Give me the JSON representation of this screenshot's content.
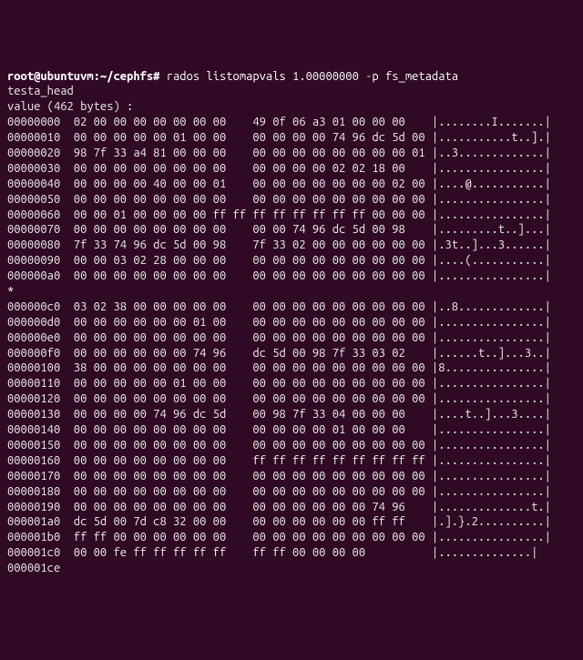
{
  "prompt": "root@ubuntuvm:~/cephfs#",
  "command": "rados listomapvals 1.00000000 -p fs_metadata",
  "header1": "testa_head",
  "header2": "value (462 bytes) :",
  "rows": [
    {
      "off": "00000000",
      "h1": "02 00 00 00 00 00 00 00",
      "h2": "49 0f 06 a3 01 00 00 00",
      "a": "|........I.......|"
    },
    {
      "off": "00000010",
      "h1": "00 00 00 00 00 01 00 00",
      "h2": "00 00 00 00 74 96 dc 5d 00",
      "a": "|...........t..].|"
    },
    {
      "off": "00000020",
      "h1": "98 7f 33 a4 81 00 00 00",
      "h2": "00 00 00 00 00 00 00 00 01",
      "a": "|..3.............|"
    },
    {
      "off": "00000030",
      "h1": "00 00 00 00 00 00 00 00",
      "h2": "00 00 00 00 02 02 18 00",
      "a": "|................|"
    },
    {
      "off": "00000040",
      "h1": "00 00 00 00 40 00 00 01",
      "h2": "00 00 00 00 00 00 00 02 00",
      "a": "|....@...........|"
    },
    {
      "off": "00000050",
      "h1": "00 00 00 00 00 00 00 00",
      "h2": "00 00 00 00 00 00 00 00 00",
      "a": "|................|"
    },
    {
      "off": "00000060",
      "h1": "00 00 01 00 00 00 00 ff ff",
      "h2": "ff ff ff ff ff ff 00 00 00",
      "a": "|................|"
    },
    {
      "off": "00000070",
      "h1": "00 00 00 00 00 00 00 00",
      "h2": "00 00 74 96 dc 5d 00 98",
      "a": "|.........t..]...|"
    },
    {
      "off": "00000080",
      "h1": "7f 33 74 96 dc 5d 00 98",
      "h2": "7f 33 02 00 00 00 00 00 00",
      "a": "|.3t..]...3......|"
    },
    {
      "off": "00000090",
      "h1": "00 00 03 02 28 00 00 00",
      "h2": "00 00 00 00 00 00 00 00 00",
      "a": "|....(...........|"
    },
    {
      "off": "000000a0",
      "h1": "00 00 00 00 00 00 00 00",
      "h2": "00 00 00 00 00 00 00 00 00",
      "a": "|................|"
    },
    {
      "off": "*",
      "h1": "",
      "h2": "",
      "a": ""
    },
    {
      "off": "000000c0",
      "h1": "03 02 38 00 00 00 00 00",
      "h2": "00 00 00 00 00 00 00 00 00",
      "a": "|..8.............|"
    },
    {
      "off": "000000d0",
      "h1": "00 00 00 00 00 00 01 00",
      "h2": "00 00 00 00 00 00 00 00 00",
      "a": "|................|"
    },
    {
      "off": "000000e0",
      "h1": "00 00 00 00 00 00 00 00",
      "h2": "00 00 00 00 00 00 00 00 00",
      "a": "|................|"
    },
    {
      "off": "000000f0",
      "h1": "00 00 00 00 00 00 74 96",
      "h2": "dc 5d 00 98 7f 33 03 02",
      "a": "|......t..]...3..|"
    },
    {
      "off": "00000100",
      "h1": "38 00 00 00 00 00 00 00",
      "h2": "00 00 00 00 00 00 00 00 00",
      "a": "|8...............|"
    },
    {
      "off": "00000110",
      "h1": "00 00 00 00 00 01 00 00",
      "h2": "00 00 00 00 00 00 00 00 00",
      "a": "|................|"
    },
    {
      "off": "00000120",
      "h1": "00 00 00 00 00 00 00 00",
      "h2": "00 00 00 00 00 00 00 00 00",
      "a": "|................|"
    },
    {
      "off": "00000130",
      "h1": "00 00 00 00 74 96 dc 5d",
      "h2": "00 98 7f 33 04 00 00 00",
      "a": "|....t..]...3....|"
    },
    {
      "off": "00000140",
      "h1": "00 00 00 00 00 00 00 00",
      "h2": "00 00 00 00 01 00 00 00",
      "a": "|................|"
    },
    {
      "off": "00000150",
      "h1": "00 00 00 00 00 00 00 00",
      "h2": "00 00 00 00 00 00 00 00 00",
      "a": "|................|"
    },
    {
      "off": "00000160",
      "h1": "00 00 00 00 00 00 00 00",
      "h2": "ff ff ff ff ff ff ff ff ff",
      "a": "|................|"
    },
    {
      "off": "00000170",
      "h1": "00 00 00 00 00 00 00 00",
      "h2": "00 00 00 00 00 00 00 00 00",
      "a": "|................|"
    },
    {
      "off": "00000180",
      "h1": "00 00 00 00 00 00 00 00",
      "h2": "00 00 00 00 00 00 00 00 00",
      "a": "|................|"
    },
    {
      "off": "00000190",
      "h1": "00 00 00 00 00 00 00 00",
      "h2": "00 00 00 00 00 00 74 96",
      "a": "|..............t.|"
    },
    {
      "off": "000001a0",
      "h1": "dc 5d 00 7d c8 32 00 00",
      "h2": "00 00 00 00 00 00 ff ff",
      "a": "|.].}.2..........|"
    },
    {
      "off": "000001b0",
      "h1": "ff ff 00 00 00 00 00 00",
      "h2": "00 00 00 00 00 00 00 00 00",
      "a": "|................|"
    },
    {
      "off": "000001c0",
      "h1": "00 00 fe ff ff ff ff ff",
      "h2": "ff ff 00 00 00 00",
      "a": "|..............|"
    },
    {
      "off": "000001ce",
      "h1": "",
      "h2": "",
      "a": ""
    }
  ]
}
